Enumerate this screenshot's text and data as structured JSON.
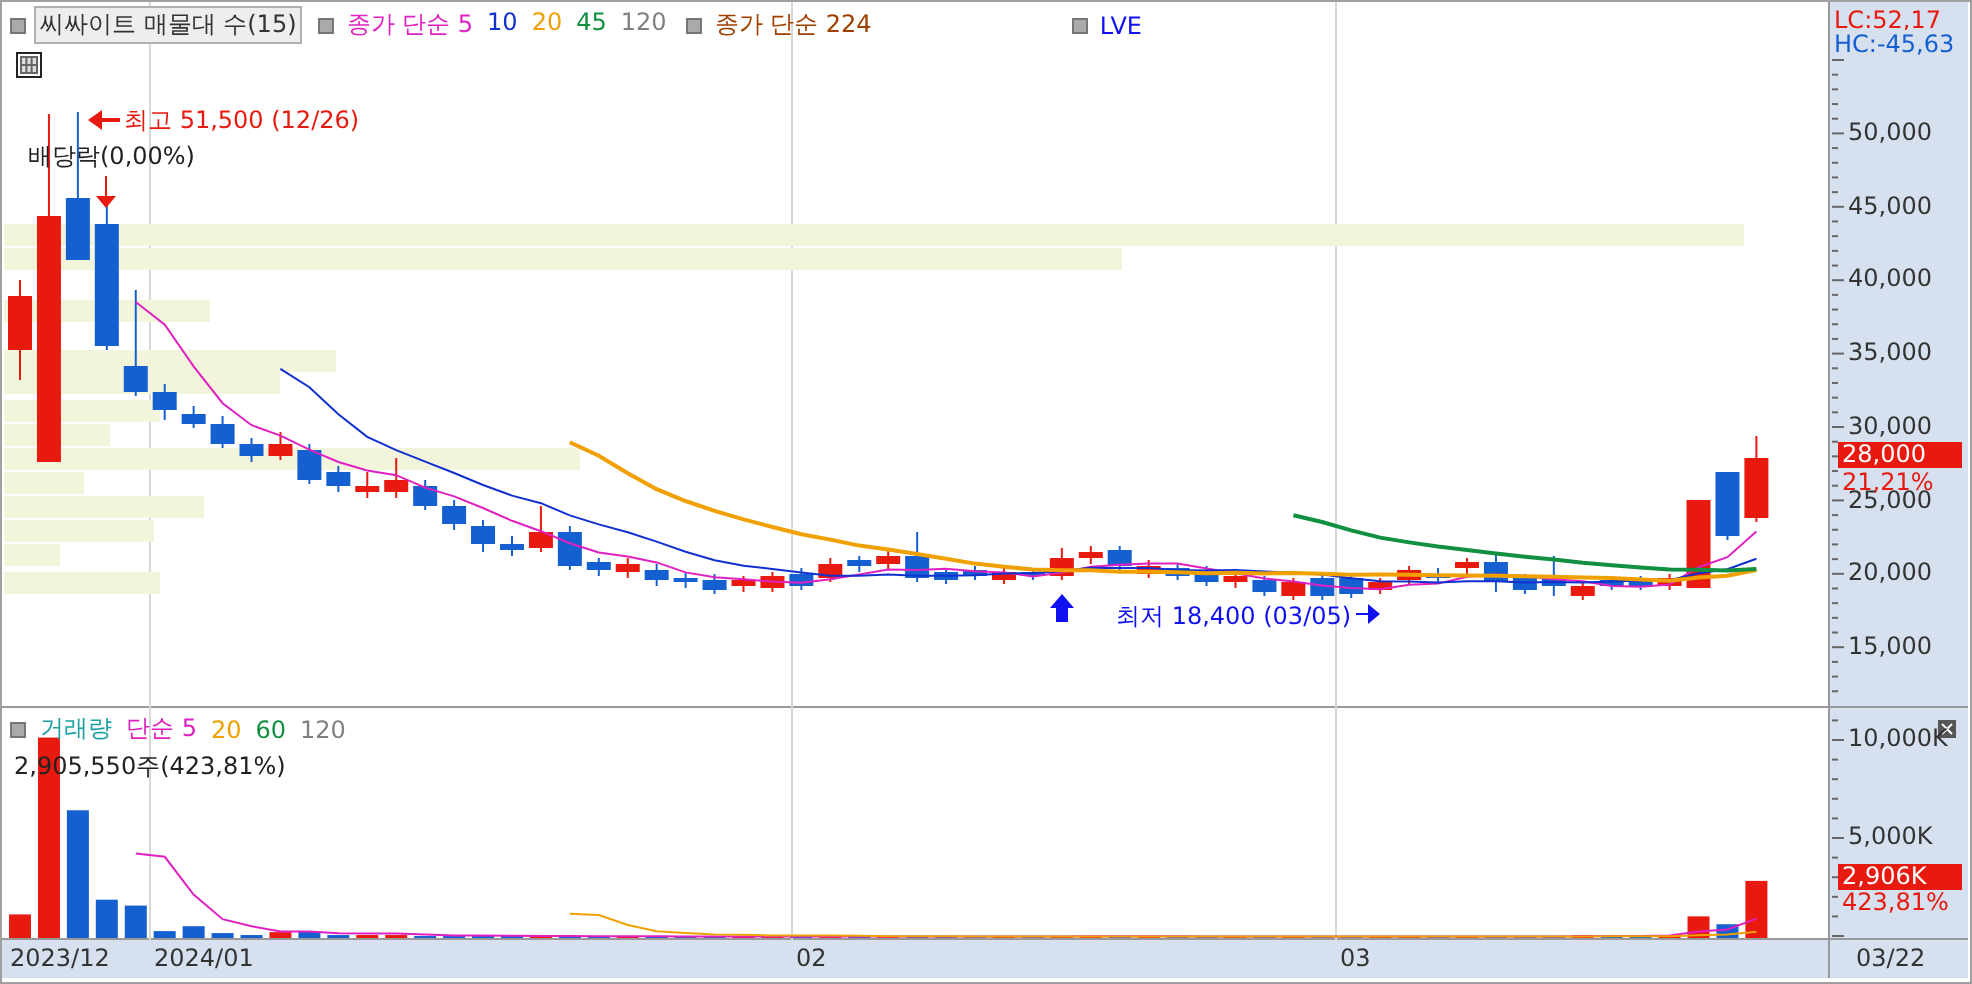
{
  "price_chart": {
    "legend": [
      {
        "kind": "indicator",
        "items": [
          {
            "text": "씨싸이트 매물대 수(15)",
            "color": "#333333"
          }
        ]
      },
      {
        "kind": "average",
        "items": [
          {
            "text": "종가 단순 5",
            "color": "#e020c0"
          },
          {
            "text": "10",
            "color": "#1030d0"
          },
          {
            "text": "20",
            "color": "#f0a000"
          },
          {
            "text": "45",
            "color": "#109040"
          },
          {
            "text": "120",
            "color": "#808080"
          }
        ]
      },
      {
        "kind": "average",
        "items": [
          {
            "text": "종가 단순 224",
            "color": "#a04000"
          }
        ]
      },
      {
        "kind": "average",
        "items": [
          {
            "text": "LVE",
            "color": "#1010f0"
          }
        ]
      }
    ],
    "annotations": [
      {
        "kind": "high",
        "text": "최고 51,500 (12/26)"
      },
      {
        "kind": "dividend",
        "text": "배당락(0,00%)"
      },
      {
        "kind": "low",
        "text": "최저 18,400 (03/05)"
      }
    ]
  },
  "price_axis": {
    "lc": "LC:52,17",
    "hc": "HC:-45,63",
    "ticks": [
      "50,000",
      "45,000",
      "40,000",
      "35,000",
      "30,000",
      "25,000",
      "20,000",
      "15,000"
    ],
    "last_price": "28,000",
    "change": "21,21%"
  },
  "volume_chart": {
    "legend": [
      {
        "text": "거래량",
        "color": "#20a0a0"
      },
      {
        "text": "단순 5",
        "color": "#e020c0"
      },
      {
        "text": "20",
        "color": "#f0a000"
      },
      {
        "text": "60",
        "color": "#109040"
      },
      {
        "text": "120",
        "color": "#808080"
      }
    ],
    "info": "2,905,550주(423,81%)",
    "axis_ticks": [
      "10,000K",
      "5,000K"
    ]
  },
  "volume_axis": {
    "last_volume": "2,906K",
    "change": "423,81%"
  },
  "date_axis": {
    "labels": [
      "2023/12",
      "2024/01",
      "02",
      "03"
    ],
    "end_label": "03/22"
  }
}
